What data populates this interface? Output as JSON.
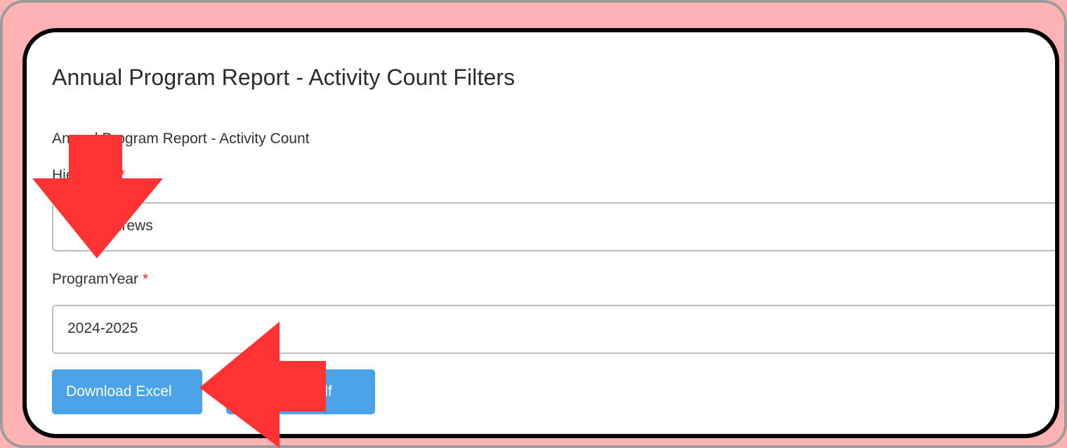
{
  "panel": {
    "title": "Annual Program Report - Activity Count Filters",
    "section_label": "Annual Program Report - Activity Count"
  },
  "fields": {
    "hierarchy": {
      "label": "Hierarchy",
      "required_marker": "*",
      "value": "Andrews"
    },
    "program_year": {
      "label": "ProgramYear",
      "required_marker": "*",
      "value": "2024-2025"
    }
  },
  "buttons": {
    "download_excel": "Download Excel",
    "download_pdf": "Download Pdf"
  },
  "annotations": {
    "arrow_color": "#ff3333",
    "arrows": [
      "down-arrow",
      "left-arrow"
    ]
  },
  "colors": {
    "background": "#ffb3b3",
    "button": "#4aa3e6",
    "required": "#e32727"
  }
}
